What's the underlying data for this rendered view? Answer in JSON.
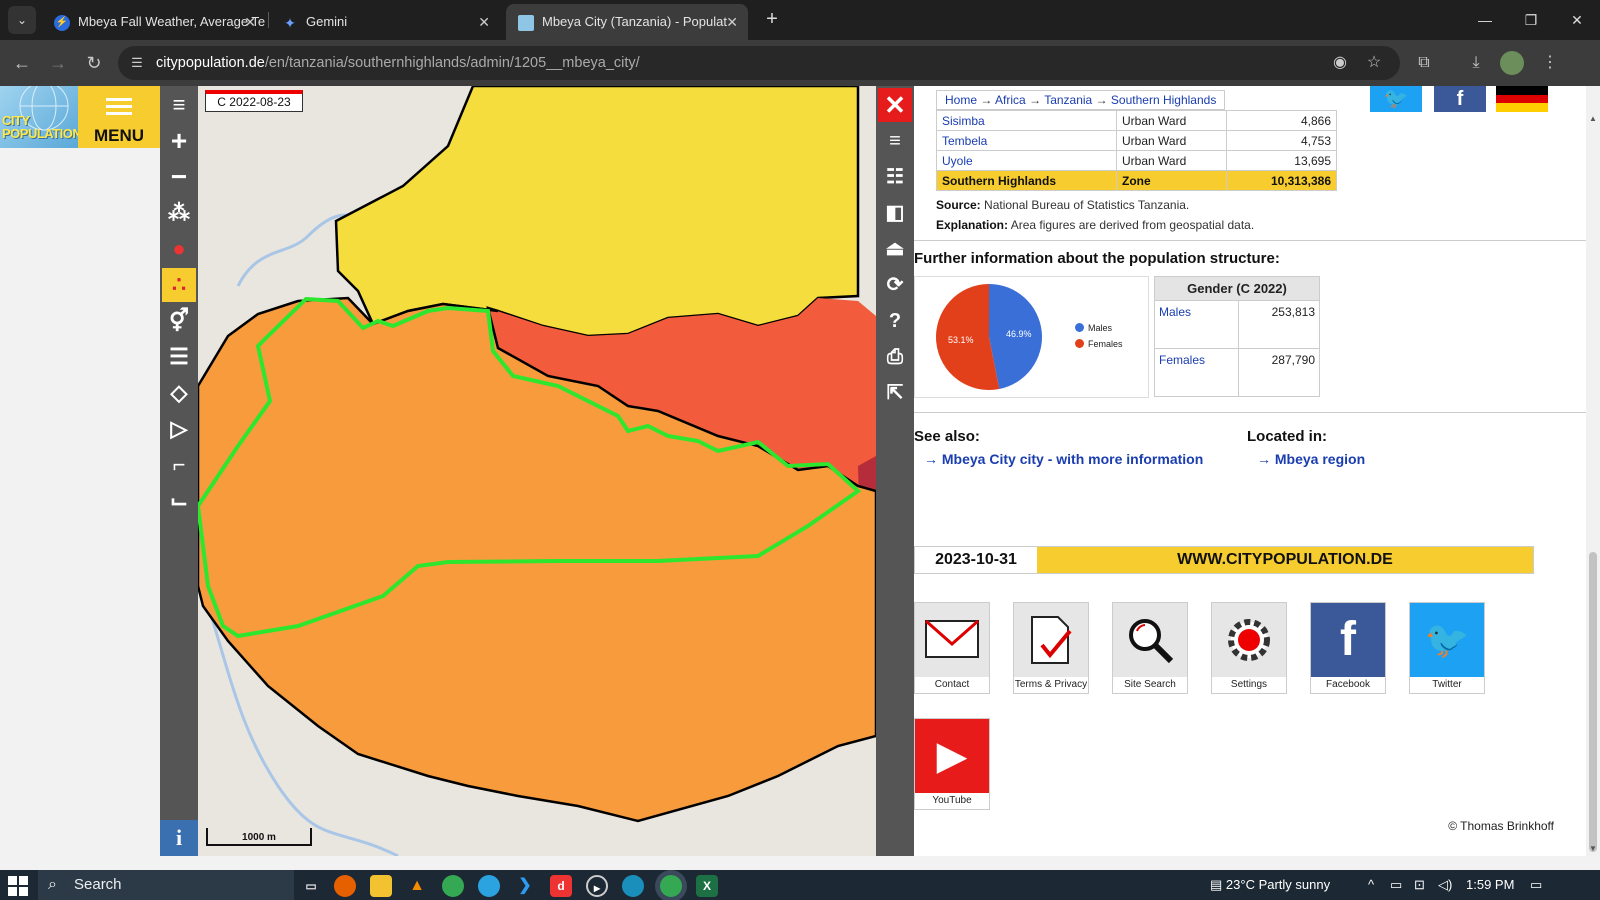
{
  "browser": {
    "tabs": [
      {
        "title": "Mbeya Fall Weather, Average Te",
        "active": false
      },
      {
        "title": "Gemini",
        "active": false
      },
      {
        "title": "Mbeya City (Tanzania) - Populat",
        "active": true
      }
    ],
    "new_tab": "+",
    "url_host": "citypopulation.de",
    "url_path": "/en/tanzania/southernhighlands/admin/1205__mbeya_city/"
  },
  "sidebar": {
    "logo_text_1": "CITY",
    "logo_text_2": "POPULATION",
    "menu_label": "MENU"
  },
  "map": {
    "date_stamp": "C 2022-08-23",
    "scale_label": "1000 m",
    "info_label": "i",
    "colors": {
      "yellow": "#f5dd3e",
      "orange": "#f79b3d",
      "red": "#f25c3c",
      "darkred": "#b52d3a",
      "outline": "#2ee62e"
    }
  },
  "breadcrumb": {
    "items": [
      "Home",
      "Africa",
      "Tanzania",
      "Southern Highlands"
    ],
    "sep": "→"
  },
  "table": {
    "rows": [
      {
        "name": "Sisimba",
        "status": "Urban Ward",
        "value": "4,866"
      },
      {
        "name": "Tembela",
        "status": "Urban Ward",
        "value": "4,753"
      },
      {
        "name": "Uyole",
        "status": "Urban Ward",
        "value": "13,695"
      }
    ],
    "total": {
      "name": "Southern Highlands",
      "status": "Zone",
      "value": "10,313,386"
    }
  },
  "notes": {
    "source_label": "Source:",
    "source_text": "National Bureau of Statistics Tanzania.",
    "explanation_label": "Explanation:",
    "explanation_text": "Area figures are derived from geospatial data."
  },
  "structure": {
    "title": "Further information about the population structure:",
    "pie": {
      "males_pct": 46.9,
      "females_pct": 53.1,
      "males_label": "46.9%",
      "females_label": "53.1%",
      "legend_males": "Males",
      "legend_females": "Females",
      "males_color": "#3b6fd8",
      "females_color": "#e2401b"
    },
    "gender_table": {
      "header": "Gender (C 2022)",
      "rows": [
        {
          "label": "Males",
          "value": "253,813"
        },
        {
          "label": "Females",
          "value": "287,790"
        }
      ]
    }
  },
  "see_also": {
    "title": "See also:",
    "link": "Mbeya City city - with more information"
  },
  "located_in": {
    "title": "Located in:",
    "link": "Mbeya region"
  },
  "footer_bar": {
    "date": "2023-10-31",
    "website": "WWW.CITYPOPULATION.DE"
  },
  "tiles": [
    {
      "label": "Contact",
      "icon": "envelope-icon"
    },
    {
      "label": "Terms & Privacy",
      "icon": "document-check-icon"
    },
    {
      "label": "Site Search",
      "icon": "magnifier-icon"
    },
    {
      "label": "Settings",
      "icon": "gear-icon"
    },
    {
      "label": "Facebook",
      "icon": "facebook-icon"
    },
    {
      "label": "Twitter",
      "icon": "twitter-icon"
    },
    {
      "label": "YouTube",
      "icon": "youtube-icon"
    }
  ],
  "copyright": "© Thomas Brinkhoff",
  "taskbar": {
    "search_label": "Search",
    "weather": "23°C  Partly sunny",
    "time": "1:59 PM"
  }
}
